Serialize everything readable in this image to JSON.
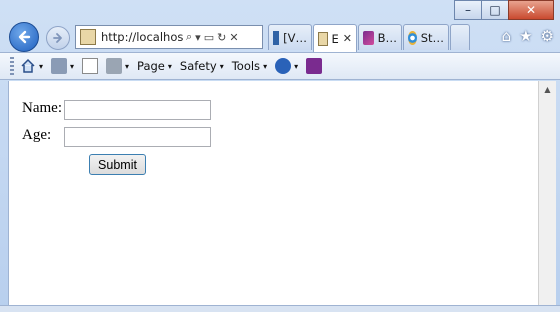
{
  "window": {
    "minimize_glyph": "–",
    "maximize_glyph": "□",
    "close_glyph": "✕"
  },
  "address_bar": {
    "url": "http://localhost:",
    "search_glyph": "⌕",
    "dropdown_glyph": "▾",
    "compat_glyph": "▭",
    "refresh_glyph": "↻",
    "stop_glyph": "✕"
  },
  "tabs": [
    {
      "label": "[V…",
      "icon": "w3schools-icon"
    },
    {
      "label": "E",
      "icon": "page-icon",
      "active": true
    },
    {
      "label": "B…",
      "icon": "onenote-pen-icon"
    },
    {
      "label": "St…",
      "icon": "ie-icon"
    }
  ],
  "toolbar_right": {
    "home_glyph": "⌂",
    "favorites_glyph": "★",
    "tools_glyph": "⚙"
  },
  "command_bar": {
    "page_label": "Page",
    "safety_label": "Safety",
    "tools_label": "Tools",
    "caret": "▾"
  },
  "form": {
    "name_label": "Name:",
    "age_label": "Age:",
    "name_value": "",
    "age_value": "",
    "submit_label": "Submit"
  },
  "colors": {
    "accent": "#1f5fbf",
    "chrome": "#cfe0f5"
  }
}
